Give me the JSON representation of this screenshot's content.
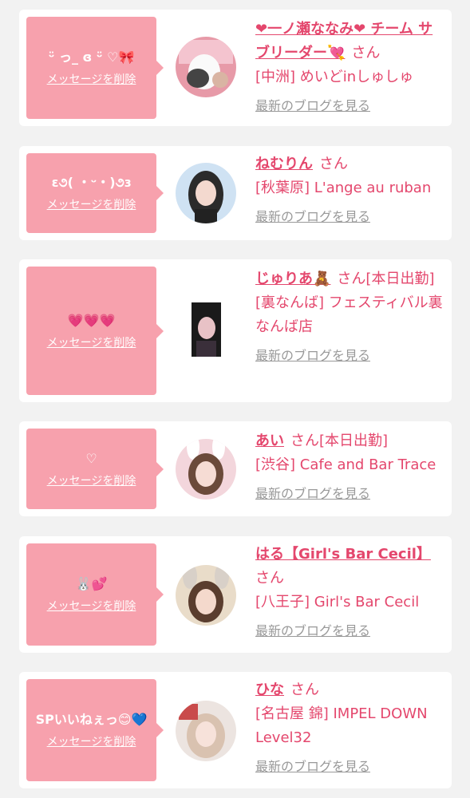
{
  "colors": {
    "accent_pink": "#e4476d",
    "bubble_pink": "#f7a1ad",
    "blog_gray": "#999999",
    "background": "#f2f2f2"
  },
  "delete_label": "メッセージを削除",
  "blog_label": "最新のブログを見る",
  "san_suffix": "さん",
  "messages": [
    {
      "message": "ᵕ̈ っ_ ɞ ᵕ̈ ♡🎀",
      "name_line": "❤一ノ瀬ななみ❤ チーム サブリーダー💘",
      "status": "",
      "shop": "[中洲] めいどinしゅしゅ"
    },
    {
      "message": "ɛ૭( ・ᵕ・)૭ɜ",
      "name_line": "ねむりん",
      "status": "",
      "shop": "[秋葉原] L'ange au ruban"
    },
    {
      "message": "💗💗💗",
      "name_line": "じゅりあ🧸",
      "status": "[本日出勤]",
      "shop": "[裏なんば] フェスティバル裏なんば店"
    },
    {
      "message": "♡",
      "name_line": "あい",
      "status": "[本日出勤]",
      "shop": "[渋谷] Cafe and Bar Trace"
    },
    {
      "message": "🐰💕",
      "name_line": "はる【Girl's Bar Cecil】",
      "status": "",
      "shop": "[八王子] Girl's Bar Cecil"
    },
    {
      "message": "SPいいねぇっ😊💙",
      "name_line": "ひな",
      "status": "",
      "shop": "[名古屋 錦] IMPEL DOWN Level32"
    }
  ]
}
